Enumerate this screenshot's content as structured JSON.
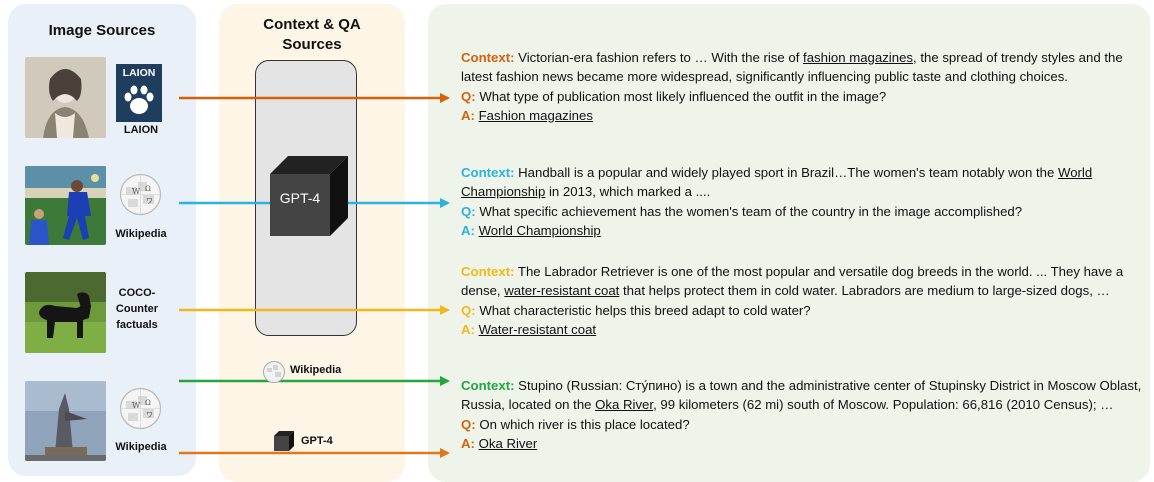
{
  "panels": {
    "image_sources_title": "Image Sources",
    "context_qa_title_1": "Context & QA",
    "context_qa_title_2": "Sources"
  },
  "sources": {
    "laion_logo_text": "LAION",
    "laion_label": "LAION",
    "wiki_label_1": "Wikipedia",
    "coco_line1": "COCO-",
    "coco_line2": "Counter",
    "coco_line3": "factuals",
    "wiki_label_2": "Wikipedia",
    "gpt4_center": "GPT-4",
    "wiki_small": "Wikipedia",
    "gpt4_small": "GPT-4"
  },
  "examples": [
    {
      "context_label": "Context:",
      "context_pre": " Victorian-era fashion refers to … With the rise of ",
      "context_key": "fashion magazines",
      "context_post": ", the spread of trendy styles and the latest fashion news became more widespread, significantly influencing public taste and clothing choices.",
      "q_label": "Q:",
      "question": " What type of publication most likely influenced the outfit in the image?",
      "a_label": "A:",
      "answer": "Fashion magazines"
    },
    {
      "context_label": "Context:",
      "context_pre": " Handball is a popular and widely played sport in Brazil…The women's team notably won the ",
      "context_key": "World Championship",
      "context_post": " in 2013, which marked a ....",
      "q_label": "Q:",
      "question": " What specific achievement has the women's team of the country in the image accomplished?",
      "a_label": "A:",
      "answer": "World Championship"
    },
    {
      "context_label": "Context:",
      "context_pre": " The Labrador Retriever is one of the most popular and versatile dog breeds in the world. ... They have a dense, ",
      "context_key": "water-resistant coat",
      "context_post": " that helps protect them in cold water. Labradors are medium to large-sized dogs, …",
      "q_label": "Q:",
      "question": " What characteristic helps this breed adapt to cold water?",
      "a_label": "A:",
      "answer": "Water-resistant coat"
    },
    {
      "context_label": "Context:",
      "context_pre": " Stupino (Russian: Сту́пино) is a town and the administrative center of Stupinsky District in Moscow Oblast, Russia, located on the ",
      "context_key": "Oka River",
      "context_post": ", 99 kilometers (62 mi) south of Moscow. Population: 66,816 (2010 Census); …",
      "q_label": "Q:",
      "question": " On which river is this place located?",
      "a_label": "A:",
      "answer": "Oka River"
    }
  ],
  "colors": {
    "orange": "#d4620d",
    "blue": "#2bb2df",
    "yellow": "#f2b81b",
    "green": "#23a640",
    "image_panel": "#e9f0f8",
    "context_panel": "#fdf5e6",
    "qa_panel": "#eef4e9"
  },
  "icons": [
    "laion-paw-icon",
    "wikipedia-globe-icon",
    "gpt4-cube-icon",
    "arrow-icon"
  ]
}
